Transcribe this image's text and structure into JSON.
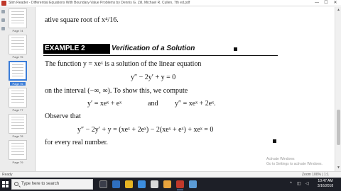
{
  "window": {
    "title": "Slim Reader - Differential Equations With Boundary-Value Problems by Dennis G. Zill, Michael R. Cullen, 7th ed.pdf",
    "minimize": "—",
    "maximize": "☐",
    "close": "✕"
  },
  "thumbnails": [
    {
      "label": "Page 74"
    },
    {
      "label": "Page 75"
    },
    {
      "label": "Page 76"
    },
    {
      "label": "Page 77"
    },
    {
      "label": "Page 78"
    },
    {
      "label": "Page 79"
    }
  ],
  "document": {
    "line_top": "ative square root of x⁴/16.",
    "example_label": "EXAMPLE 2",
    "example_title": "Verification of a Solution",
    "line1": "The function y = xeˣ is a solution of the linear equation",
    "equation1": "y″ − 2y′ + y = 0",
    "line2": "on the interval (−∞, ∞). To show this, we compute",
    "equation2a": "y′ = xeˣ + eˣ",
    "equation2_and": "and",
    "equation2b": "y″ = xeˣ + 2eˣ.",
    "line3": "Observe that",
    "equation3": "y″ − 2y′ + y = (xeˣ + 2eˣ) − 2(xeˣ + eˣ) + xeˣ = 0",
    "line4": "for every real number."
  },
  "statusbar": {
    "status": "Ready",
    "zoom": "Zoom 100% | 1:1"
  },
  "watermark": {
    "line1": "Activate Windows",
    "line2": "Go to Settings to activate Windows."
  },
  "taskbar": {
    "search_placeholder": "Type here to search",
    "tray_up": "^",
    "tray_network": "◫",
    "tray_volume": "◁",
    "time": "10:47 AM",
    "date": "3/16/2018"
  },
  "colors": {
    "taskbar": "#1d1f27",
    "selection": "#3b7dd8"
  }
}
